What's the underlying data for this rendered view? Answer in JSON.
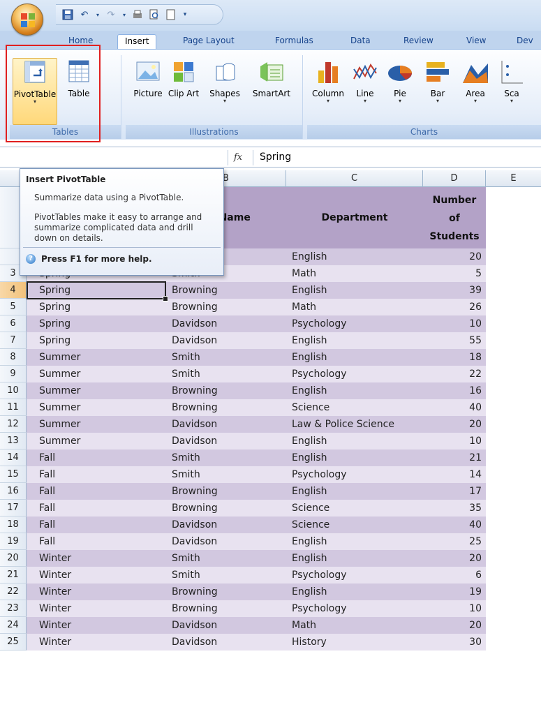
{
  "colors": {
    "header_fill": "#b3a2c7",
    "band_dark": "#d2c8e0",
    "band_light": "#e8e2f0",
    "highlight": "#e02020"
  },
  "tabs": [
    "Home",
    "Insert",
    "Page Layout",
    "Formulas",
    "Data",
    "Review",
    "View",
    "Dev"
  ],
  "active_tab": "Insert",
  "ribbon": {
    "tables": {
      "label": "Tables",
      "buttons": [
        "PivotTable",
        "Table"
      ]
    },
    "illustrations": {
      "label": "Illustrations",
      "buttons": [
        "Picture",
        "Clip Art",
        "Shapes",
        "SmartArt"
      ]
    },
    "charts": {
      "label": "Charts",
      "buttons": [
        "Column",
        "Line",
        "Pie",
        "Bar",
        "Area",
        "Sca"
      ]
    }
  },
  "formula_bar": {
    "fx": "fx",
    "value": "Spring"
  },
  "columns": [
    "B",
    "C",
    "D",
    "E"
  ],
  "header": {
    "instructor": "r's Name",
    "department": "Department",
    "students_line1": "Number",
    "students_line2": "of",
    "students_line3": "Students"
  },
  "rows": [
    {
      "num": "",
      "semester": "",
      "instructor": "",
      "department": "English",
      "students": "20"
    },
    {
      "num": "3",
      "semester": "Spring",
      "instructor": "Smith",
      "department": "Math",
      "students": "5"
    },
    {
      "num": "4",
      "semester": "Spring",
      "instructor": "Browning",
      "department": "English",
      "students": "39"
    },
    {
      "num": "5",
      "semester": "Spring",
      "instructor": "Browning",
      "department": "Math",
      "students": "26"
    },
    {
      "num": "6",
      "semester": "Spring",
      "instructor": "Davidson",
      "department": "Psychology",
      "students": "10"
    },
    {
      "num": "7",
      "semester": "Spring",
      "instructor": "Davidson",
      "department": "English",
      "students": "55"
    },
    {
      "num": "8",
      "semester": "Summer",
      "instructor": "Smith",
      "department": "English",
      "students": "18"
    },
    {
      "num": "9",
      "semester": "Summer",
      "instructor": "Smith",
      "department": "Psychology",
      "students": "22"
    },
    {
      "num": "10",
      "semester": "Summer",
      "instructor": "Browning",
      "department": "English",
      "students": "16"
    },
    {
      "num": "11",
      "semester": "Summer",
      "instructor": "Browning",
      "department": "Science",
      "students": "40"
    },
    {
      "num": "12",
      "semester": "Summer",
      "instructor": "Davidson",
      "department": "Law & Police Science",
      "students": "20"
    },
    {
      "num": "13",
      "semester": "Summer",
      "instructor": "Davidson",
      "department": "English",
      "students": "10"
    },
    {
      "num": "14",
      "semester": "Fall",
      "instructor": "Smith",
      "department": "English",
      "students": "21"
    },
    {
      "num": "15",
      "semester": "Fall",
      "instructor": "Smith",
      "department": "Psychology",
      "students": "14"
    },
    {
      "num": "16",
      "semester": "Fall",
      "instructor": "Browning",
      "department": "English",
      "students": "17"
    },
    {
      "num": "17",
      "semester": "Fall",
      "instructor": "Browning",
      "department": "Science",
      "students": "35"
    },
    {
      "num": "18",
      "semester": "Fall",
      "instructor": "Davidson",
      "department": "Science",
      "students": "40"
    },
    {
      "num": "19",
      "semester": "Fall",
      "instructor": "Davidson",
      "department": "English",
      "students": "25"
    },
    {
      "num": "20",
      "semester": "Winter",
      "instructor": "Smith",
      "department": "English",
      "students": "20"
    },
    {
      "num": "21",
      "semester": "Winter",
      "instructor": "Smith",
      "department": "Psychology",
      "students": "6"
    },
    {
      "num": "22",
      "semester": "Winter",
      "instructor": "Browning",
      "department": "English",
      "students": "19"
    },
    {
      "num": "23",
      "semester": "Winter",
      "instructor": "Browning",
      "department": "Psychology",
      "students": "10"
    },
    {
      "num": "24",
      "semester": "Winter",
      "instructor": "Davidson",
      "department": "Math",
      "students": "20"
    },
    {
      "num": "25",
      "semester": "Winter",
      "instructor": "Davidson",
      "department": "History",
      "students": "30"
    }
  ],
  "tooltip": {
    "title": "Insert PivotTable",
    "summary": "Summarize data using a PivotTable.",
    "body": "PivotTables make it easy to arrange and summarize complicated data and drill down on details.",
    "help": "Press F1 for more help."
  }
}
